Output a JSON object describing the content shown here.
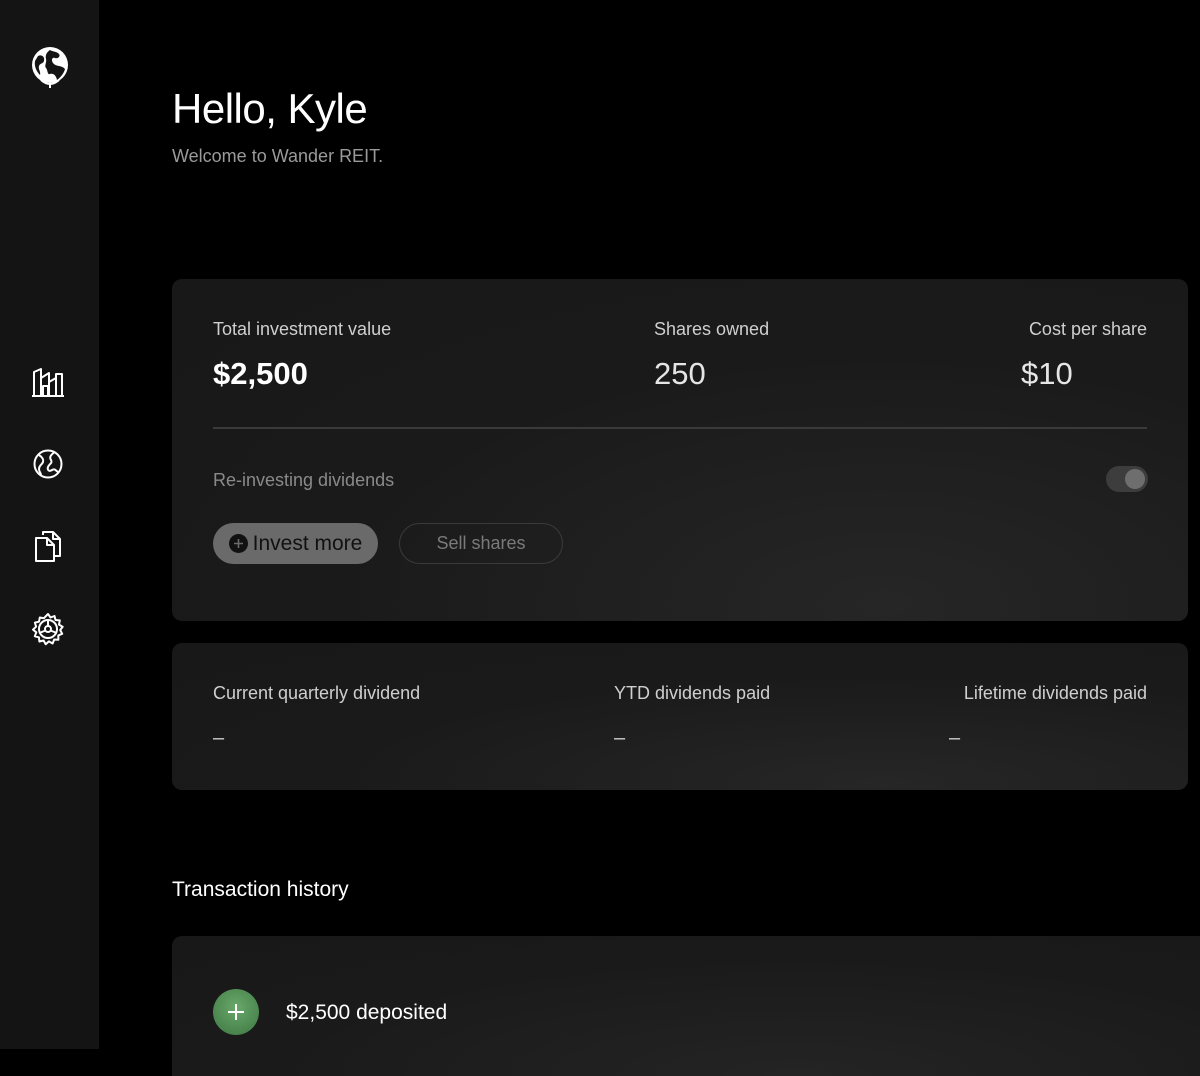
{
  "header": {
    "greeting": "Hello, Kyle",
    "subtitle": "Welcome to Wander REIT."
  },
  "sidebar": {
    "logo_icon": "globe-icon",
    "items": [
      {
        "id": "properties",
        "icon": "buildings-icon"
      },
      {
        "id": "explore",
        "icon": "globe-outline-icon"
      },
      {
        "id": "documents",
        "icon": "documents-icon"
      },
      {
        "id": "settings",
        "icon": "gear-icon"
      }
    ]
  },
  "investment": {
    "total_label": "Total investment value",
    "total_value": "$2,500",
    "shares_label": "Shares owned",
    "shares_value": "250",
    "cost_label": "Cost per share",
    "cost_value": "$10",
    "reinvest_label": "Re-investing dividends",
    "reinvest_enabled": true,
    "invest_button": "Invest more",
    "sell_button": "Sell shares"
  },
  "dividends": {
    "quarterly_label": "Current quarterly dividend",
    "quarterly_value": "–",
    "ytd_label": "YTD dividends paid",
    "ytd_value": "–",
    "lifetime_label": "Lifetime dividends paid",
    "lifetime_value": "–"
  },
  "transactions": {
    "title": "Transaction history",
    "items": [
      {
        "icon": "plus-icon",
        "text": "$2,500 deposited",
        "color": "#4e8a52"
      }
    ]
  }
}
